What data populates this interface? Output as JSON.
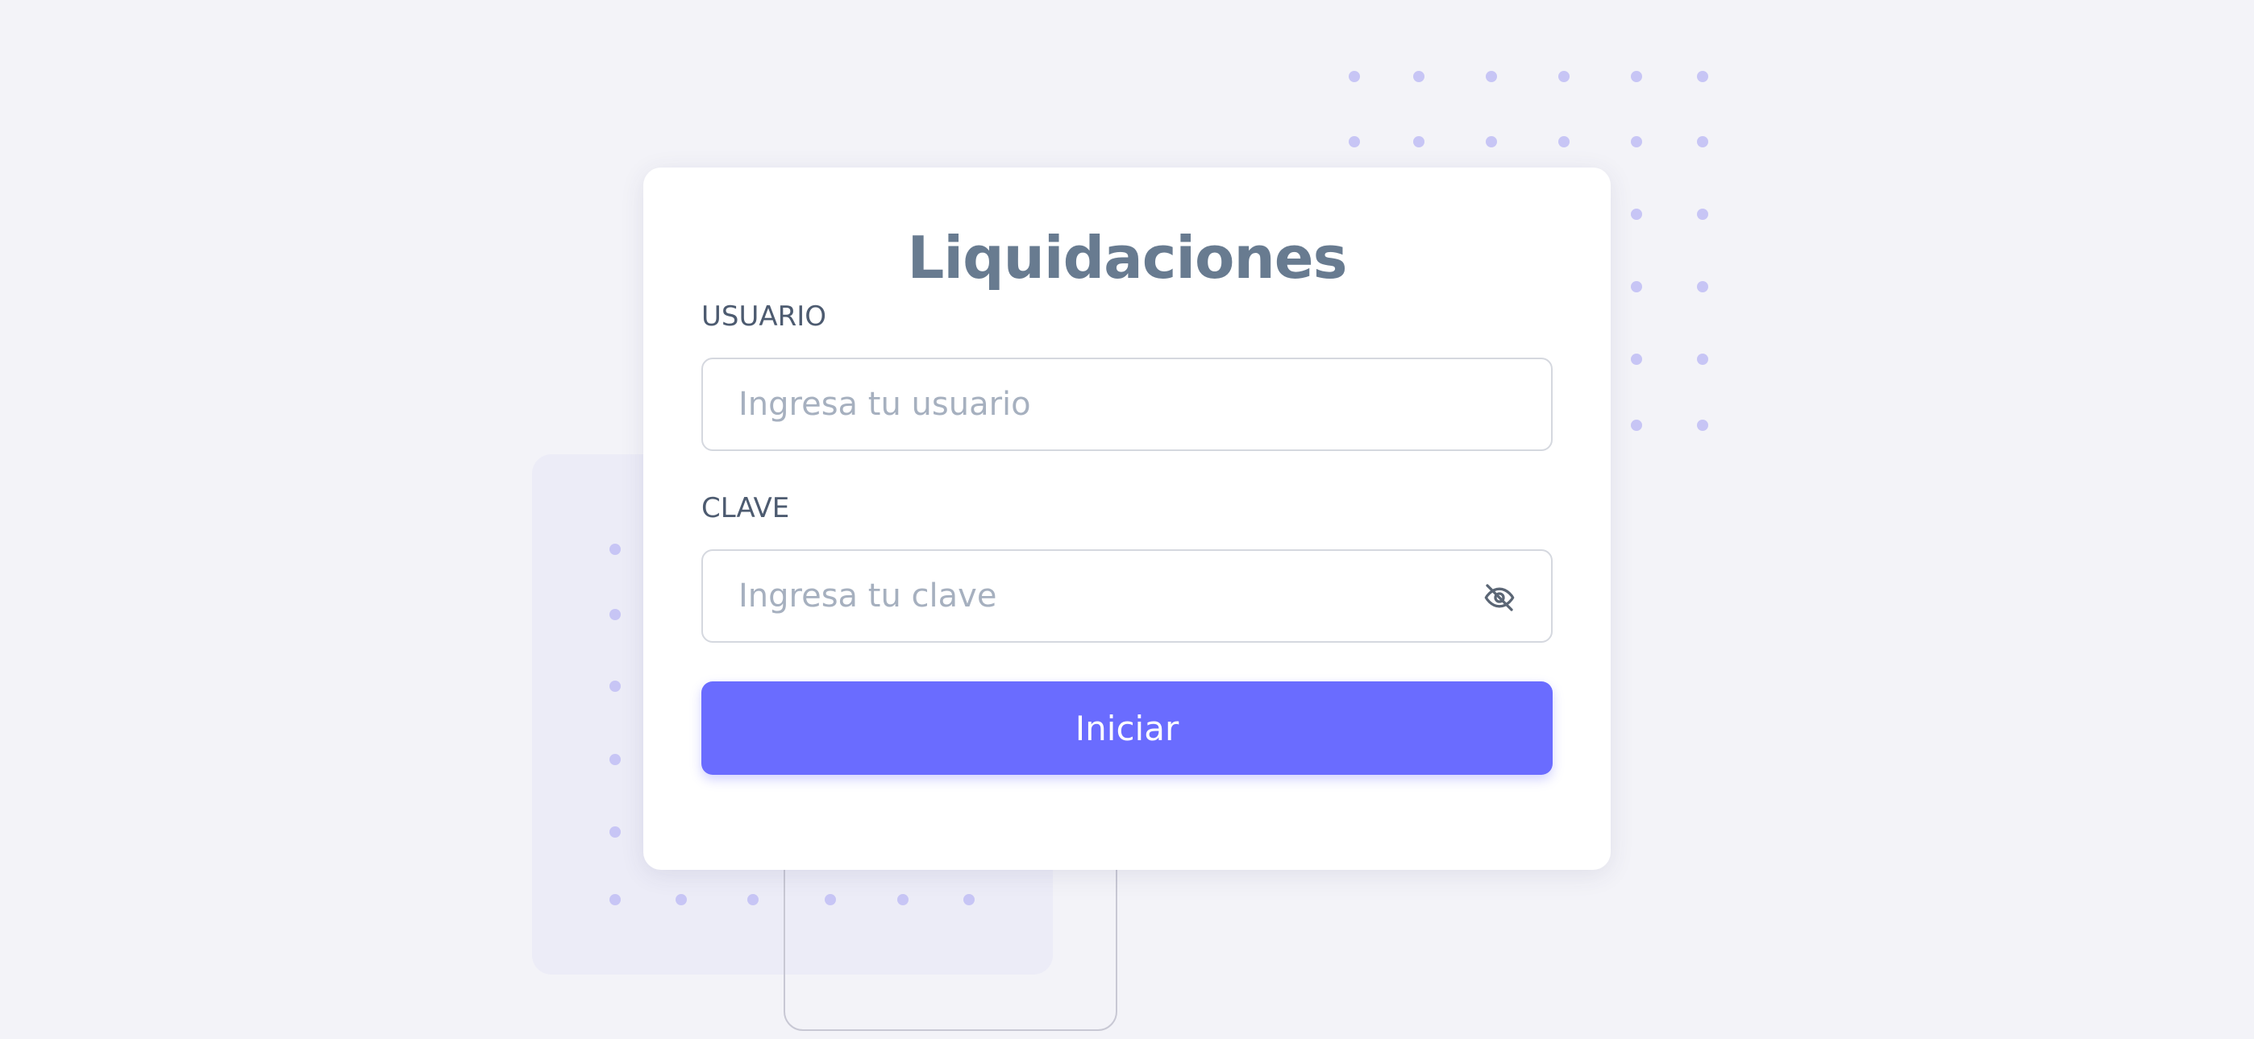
{
  "app": {
    "title": "Liquidaciones"
  },
  "form": {
    "user_label": "USUARIO",
    "user_placeholder": "Ingresa tu usuario",
    "user_value": "",
    "password_label": "CLAVE",
    "password_placeholder": "Ingresa tu clave",
    "password_value": "",
    "password_toggle_icon": "eye-slash-icon",
    "submit_label": "Iniciar"
  },
  "colors": {
    "background": "#f3f3f8",
    "card": "#ffffff",
    "title": "#687b90",
    "label": "#4d5b70",
    "accent": "#6a6cff",
    "decor_dot": "#c7c5f5"
  }
}
